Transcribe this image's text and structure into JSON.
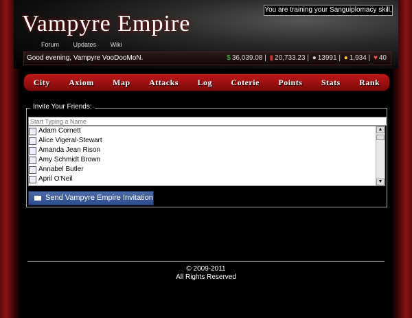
{
  "header": {
    "title_big": "Vampyre Empire",
    "notice": "You are training your Sanguiplomacy skill.",
    "topnav": [
      "Forum",
      "Updates",
      "Wiki"
    ]
  },
  "status": {
    "greeting": "Good evening, Vampyre VooDooMoN.",
    "money": "36,039.08",
    "blood": "20,733.23",
    "population": "13991",
    "gold": "1,934",
    "hearts": "40"
  },
  "menu": [
    "City",
    "Axiom",
    "Map",
    "Attacks",
    "Log",
    "Coterie",
    "Points",
    "Stats",
    "Rank"
  ],
  "invite": {
    "legend": "Invite Your Friends:",
    "placeholder": "Start Typing a Name",
    "friends": [
      "Adam Cornett",
      "Alice Vigeral-Stewart",
      "Amanda Jean Rison",
      "Amy Schmidt Brown",
      "Annabel Butler",
      "April O'Neil"
    ],
    "send_label": "Send Vampyre Empire Invitation"
  },
  "footer": {
    "copyright": "© 2009-2011",
    "rights": "All Rights Reserved"
  }
}
